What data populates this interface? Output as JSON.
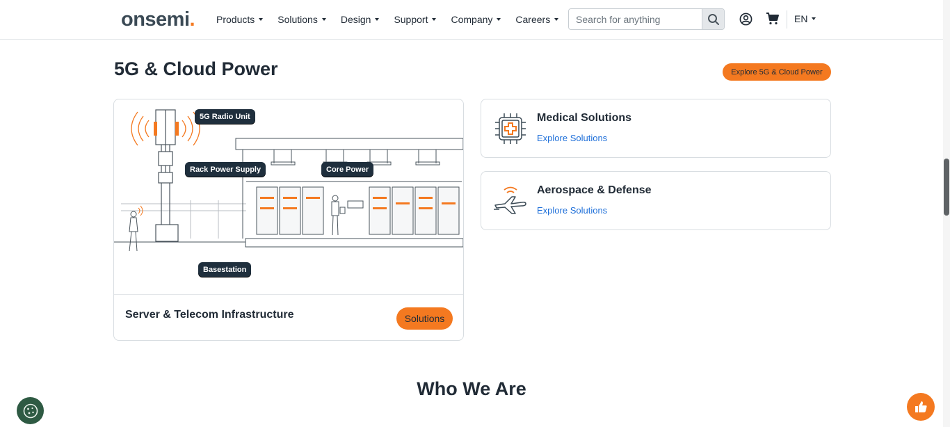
{
  "header": {
    "logo_text": "onsemi",
    "logo_suffix": ".",
    "nav": [
      {
        "label": "Products"
      },
      {
        "label": "Solutions"
      },
      {
        "label": "Design"
      },
      {
        "label": "Support"
      },
      {
        "label": "Company"
      },
      {
        "label": "Careers"
      }
    ],
    "search": {
      "placeholder": "Search for anything",
      "value": ""
    },
    "icons": {
      "search": "search-icon",
      "user": "user-icon",
      "cart": "cart-icon"
    },
    "language": "EN"
  },
  "section": {
    "title": "5G & Cloud Power",
    "explore_label": "Explore 5G & Cloud Power"
  },
  "main_card": {
    "title": "Server & Telecom Infrastructure",
    "button_label": "Solutions",
    "tags": {
      "radio": "5G Radio Unit",
      "rack": "Rack Power Supply",
      "core": "Core Power",
      "base": "Basestation"
    }
  },
  "side_cards": [
    {
      "title": "Medical Solutions",
      "link": "Explore Solutions",
      "icon": "medical-chip-icon"
    },
    {
      "title": "Aerospace & Defense",
      "link": "Explore Solutions",
      "icon": "airplane-icon"
    }
  ],
  "who_title": "Who We Are",
  "colors": {
    "accent": "#f47920",
    "link": "#1e6fd9",
    "dark": "#212b36",
    "tag": "#1f2f3d",
    "cookie": "#2e5a43"
  }
}
